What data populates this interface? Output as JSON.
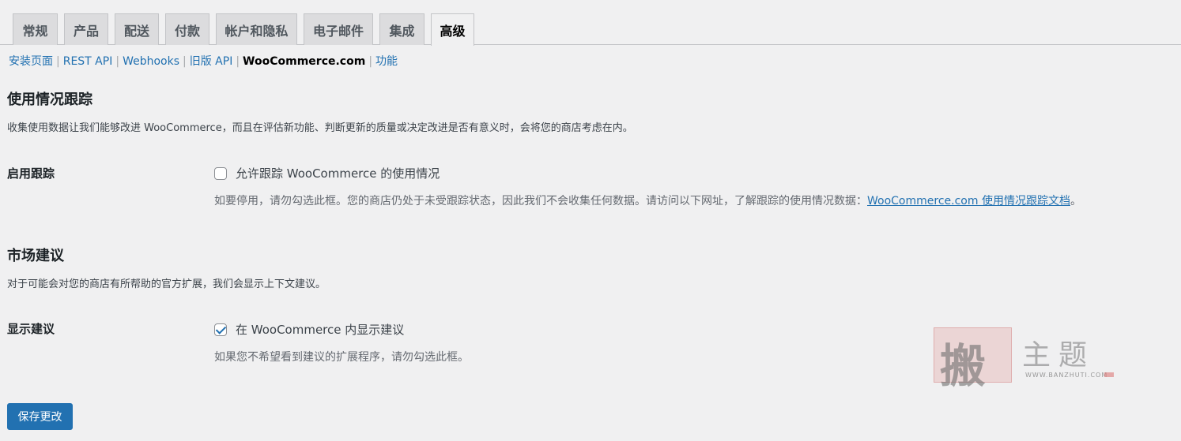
{
  "tabs": [
    {
      "label": "常规"
    },
    {
      "label": "产品"
    },
    {
      "label": "配送"
    },
    {
      "label": "付款"
    },
    {
      "label": "帐户和隐私"
    },
    {
      "label": "电子邮件"
    },
    {
      "label": "集成"
    },
    {
      "label": "高级",
      "active": true
    }
  ],
  "subnav": {
    "items": [
      "安装页面",
      "REST API",
      "Webhooks",
      "旧版 API",
      "WooCommerce.com",
      "功能"
    ],
    "separator": "|",
    "current": "WooCommerce.com"
  },
  "tracking": {
    "heading": "使用情况跟踪",
    "description": "收集使用数据让我们能够改进 WooCommerce，而且在评估新功能、判断更新的质量或决定改进是否有意义时，会将您的商店考虑在内。",
    "label": "启用跟踪",
    "checkbox_label": "允许跟踪 WooCommerce 的使用情况",
    "checked": false,
    "help_text": "如要停用，请勿勾选此框。您的商店仍处于未受跟踪状态，因此我们不会收集任何数据。请访问以下网址，了解跟踪的使用情况数据：",
    "help_link": "WooCommerce.com 使用情况跟踪文档",
    "help_end": "。"
  },
  "marketplace": {
    "heading": "市场建议",
    "description": "对于可能会对您的商店有所帮助的官方扩展，我们会显示上下文建议。",
    "label": "显示建议",
    "checkbox_label": "在 WooCommerce 内显示建议",
    "checked": true,
    "help_text": "如果您不希望看到建议的扩展程序，请勿勾选此框。"
  },
  "save_button": "保存更改",
  "watermark": {
    "char": "搬",
    "text": "主题",
    "sub": "WWW.BANZHUTI.COM"
  },
  "colors": {
    "accent": "#2271b1",
    "background": "#f0f0f1"
  }
}
